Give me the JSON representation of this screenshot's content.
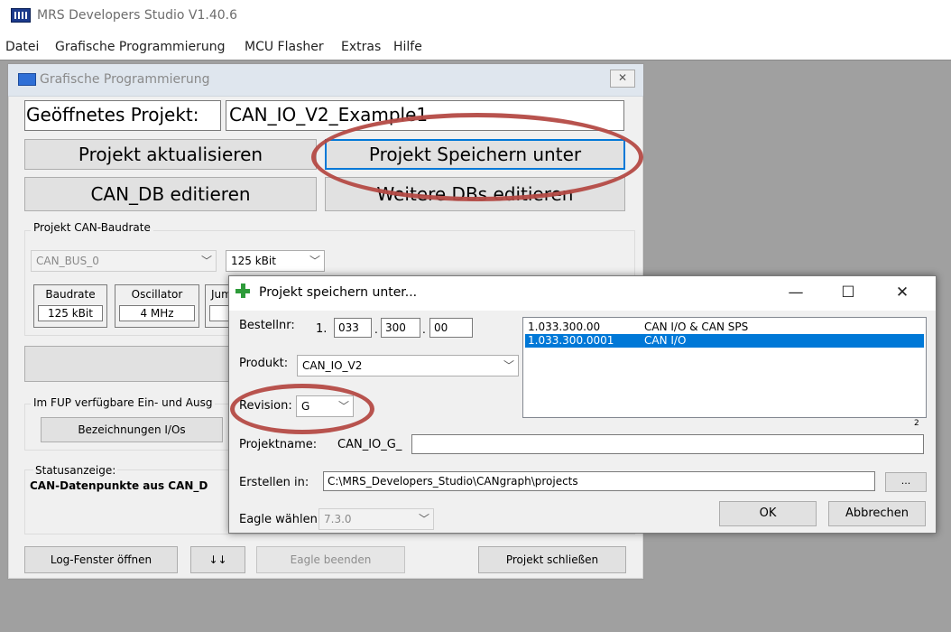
{
  "app": {
    "title": "MRS Developers Studio V1.40.6",
    "menu": [
      "Datei",
      "Grafische Programmierung",
      "MCU Flasher",
      "Extras",
      "Hilfe"
    ]
  },
  "gp_window": {
    "title": "Grafische Programmierung",
    "close_glyph": "✕",
    "open_project_label": "Geöffnetes Projekt:",
    "open_project_value": "CAN_IO_V2_Example1",
    "btn_update": "Projekt aktualisieren",
    "btn_save_as": "Projekt Speichern unter",
    "btn_can_db": "CAN_DB editieren",
    "btn_more_dbs": "Weitere DBs editieren",
    "baud_group_label": "Projekt CAN-Baudrate",
    "can_bus_value": "CAN_BUS_0",
    "baud_value": "125 kBit",
    "frame_baudrate_label": "Baudrate",
    "frame_baudrate_value": "125 kBit",
    "frame_oscillator_label": "Oscillator",
    "frame_oscillator_value": "4 MHz",
    "frame_jumper_label": "Jum",
    "fup_label": "Im FUP verfügbare Ein- und Ausg",
    "btn_io_names": "Bezeichnungen I/Os",
    "status_label": "Statusanzeige:",
    "status_text": "CAN-Datenpunkte aus CAN_D",
    "btn_log": "Log-Fenster öffnen",
    "btn_arrows": "↓↓",
    "btn_eagle_end": "Eagle beenden",
    "btn_close_project": "Projekt schließen"
  },
  "dialog": {
    "title": "Projekt speichern unter...",
    "minimize": "—",
    "maximize": "☐",
    "close": "✕",
    "order_label": "Bestellnr:",
    "order_prefix": "1.",
    "order_part1": "033",
    "order_part2": "300",
    "order_part3": "00",
    "product_label": "Produkt:",
    "product_value": "CAN_IO_V2",
    "revision_label": "Revision:",
    "revision_value": "G",
    "list_count": "2",
    "list_rows": [
      {
        "id": "1.033.300.00",
        "name": "CAN I/O & CAN SPS",
        "selected": false
      },
      {
        "id": "1.033.300.0001",
        "name": "CAN I/O",
        "selected": true
      }
    ],
    "projname_label": "Projektname:",
    "projname_prefix": "CAN_IO_G_",
    "projname_value": "",
    "create_in_label": "Erstellen in:",
    "create_in_value": "C:\\MRS_Developers_Studio\\CANgraph\\projects",
    "browse_label": "...",
    "eagle_label": "Eagle wählen:",
    "eagle_value": "7.3.0",
    "ok_label": "OK",
    "cancel_label": "Abbrechen"
  },
  "colors": {
    "highlight_oval": "#b44a45",
    "selection": "#0078d7",
    "workspace": "#a0a0a0"
  }
}
